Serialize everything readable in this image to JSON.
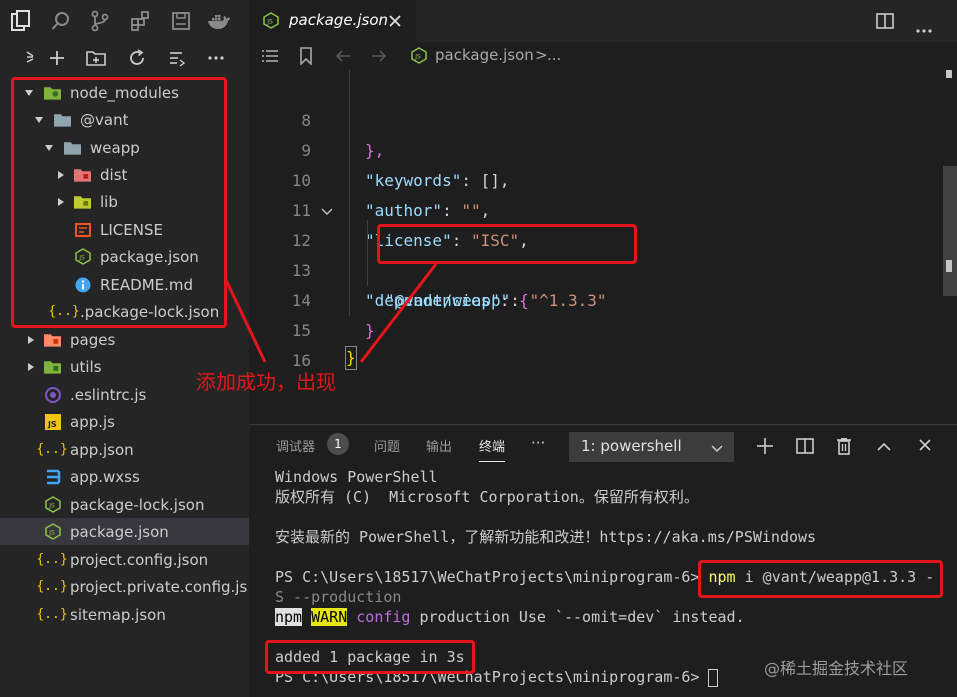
{
  "tab": {
    "label": "package.json"
  },
  "breadcrumb": {
    "file": "package.json",
    "sep": ">",
    "rest": "..."
  },
  "explorer": {
    "items": [
      {
        "name": "node_modules"
      },
      {
        "name": "@vant"
      },
      {
        "name": "weapp"
      },
      {
        "name": "dist"
      },
      {
        "name": "lib"
      },
      {
        "name": "LICENSE"
      },
      {
        "name": "package.json"
      },
      {
        "name": "README.md"
      },
      {
        "name": ".package-lock.json"
      },
      {
        "name": "pages"
      },
      {
        "name": "utils"
      },
      {
        "name": ".eslintrc.js"
      },
      {
        "name": "app.js"
      },
      {
        "name": "app.json"
      },
      {
        "name": "app.wxss"
      },
      {
        "name": "package-lock.json"
      },
      {
        "name": "package.json"
      },
      {
        "name": "project.config.json"
      },
      {
        "name": "project.private.config.js..."
      },
      {
        "name": "sitemap.json"
      }
    ]
  },
  "editor": {
    "line_numbers": [
      "8",
      "9",
      "10",
      "11",
      "12",
      "13",
      "14",
      "15",
      "16"
    ],
    "lines": {
      "l8": "},",
      "l9_key": "\"keywords\"",
      "l9_rest": ": [],",
      "l10_key": "\"author\"",
      "l10_colon": ": ",
      "l10_val": "\"\"",
      "l10_comma": ",",
      "l11_key": "\"license\"",
      "l11_colon": ": ",
      "l11_val": "\"ISC\"",
      "l11_comma": ",",
      "l12_key": "\"dependencies\"",
      "l12_colon": ": ",
      "l12_brace": "{",
      "l13_key": "\"@vant/weapp\"",
      "l13_colon": ": ",
      "l13_val": "\"^1.3.3\"",
      "l14": "}",
      "l15": "}"
    }
  },
  "panel": {
    "tabs": [
      "调试器",
      "问题",
      "输出",
      "终端"
    ],
    "badge": "1",
    "more": "···",
    "terminal_select": "1: powershell"
  },
  "terminal": {
    "line1": "Windows PowerShell",
    "line2": "版权所有 (C)  Microsoft Corporation。保留所有权利。",
    "line3": "安装最新的 PowerShell，了解新功能和改进！https://aka.ms/PSWindows",
    "prompt1": "PS C:\\Users\\18517\\WeChatProjects\\miniprogram-6> ",
    "cmd_npm": "npm",
    "cmd_rest": " i @vant/weapp@1.3.3 -",
    "line5": "S --production",
    "warn_npm": "npm",
    "warn_tag": "WARN",
    "warn_config": " config",
    "warn_msg": " production Use `--omit=dev` instead.",
    "added": "added 1 package in 3s",
    "prompt2": "PS C:\\Users\\18517\\WeChatProjects\\miniprogram-6> "
  },
  "annotation": {
    "text": "添加成功，出现"
  },
  "watermark": {
    "text": "@稀土掘金技术社区"
  },
  "colors": {
    "annotation_red": "#e6151c",
    "folder_green": "#7fb33b",
    "json_yellow": "#f1c40f",
    "js_green": "#8bc34a"
  }
}
